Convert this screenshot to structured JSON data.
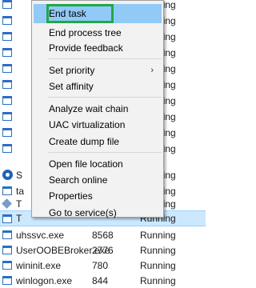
{
  "process_list": {
    "rows": [
      {
        "name": "",
        "pid": "",
        "status": "Running",
        "icon": "window-icon"
      },
      {
        "name": "",
        "pid": "",
        "status": "Running",
        "icon": "window-icon"
      },
      {
        "name": "",
        "pid": "",
        "status": "Running",
        "icon": "window-icon"
      },
      {
        "name": "",
        "pid": "",
        "status": "Running",
        "icon": "window-icon"
      },
      {
        "name": "",
        "pid": "",
        "status": "Running",
        "icon": "window-icon"
      },
      {
        "name": "",
        "pid": "",
        "status": "Running",
        "icon": "window-icon"
      },
      {
        "name": "",
        "pid": "",
        "status": "Running",
        "icon": "window-icon"
      },
      {
        "name": "",
        "pid": "",
        "status": "Running",
        "icon": "window-icon"
      },
      {
        "name": "",
        "pid": "",
        "status": "Running",
        "icon": "window-icon"
      },
      {
        "name": "",
        "pid": "",
        "status": "Running",
        "icon": "window-icon"
      },
      {
        "name": "S",
        "pid": "",
        "status": "Running",
        "icon": "gear-icon"
      },
      {
        "name": "ta",
        "pid": "",
        "status": "Running",
        "icon": "window-icon"
      },
      {
        "name": "T",
        "pid": "",
        "status": "Running",
        "icon": "tools-icon"
      },
      {
        "name": "T",
        "pid": "",
        "status": "Running",
        "icon": "window-icon"
      },
      {
        "name": "uhssvc.exe",
        "pid": "8568",
        "status": "Running",
        "icon": "window-icon"
      },
      {
        "name": "UserOOBEBroker.exe",
        "pid": "2776",
        "status": "Running",
        "icon": "window-icon"
      },
      {
        "name": "wininit.exe",
        "pid": "780",
        "status": "Running",
        "icon": "window-icon"
      },
      {
        "name": "winlogon.exe",
        "pid": "844",
        "status": "Running",
        "icon": "window-icon"
      }
    ]
  },
  "context_menu": {
    "items": [
      {
        "label": "End task",
        "submenu": false
      },
      {
        "label": "End process tree",
        "submenu": false
      },
      {
        "label": "Provide feedback",
        "submenu": false
      },
      {
        "label": "Set priority",
        "submenu": true
      },
      {
        "label": "Set affinity",
        "submenu": false
      },
      {
        "label": "Analyze wait chain",
        "submenu": false
      },
      {
        "label": "UAC virtualization",
        "submenu": false
      },
      {
        "label": "Create dump file",
        "submenu": false
      },
      {
        "label": "Open file location",
        "submenu": false
      },
      {
        "label": "Search online",
        "submenu": false
      },
      {
        "label": "Properties",
        "submenu": false
      },
      {
        "label": "Go to service(s)",
        "submenu": false
      }
    ],
    "submenu_arrow": "›"
  },
  "colors": {
    "menu_highlight": "#91c9f7",
    "focus_outline": "#20a845",
    "selected_row": "#cce8ff"
  }
}
